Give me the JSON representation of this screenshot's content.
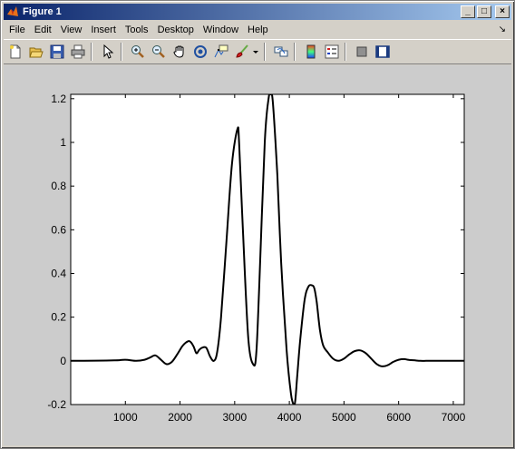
{
  "window": {
    "title": "Figure 1",
    "minimize_label": "_",
    "maximize_label": "□",
    "close_label": "×"
  },
  "menubar": {
    "items": [
      "File",
      "Edit",
      "View",
      "Insert",
      "Tools",
      "Desktop",
      "Window",
      "Help"
    ],
    "dock_arrow": "↘"
  },
  "toolbar": {
    "tools": [
      "new-figure-icon",
      "open-file-icon",
      "save-icon",
      "print-icon",
      "edit-plot-arrow-icon",
      "zoom-in-icon",
      "zoom-out-icon",
      "pan-hand-icon",
      "rotate-3d-icon",
      "data-cursor-icon",
      "brush-icon",
      "link-plot-icon",
      "colorbar-icon",
      "legend-icon",
      "hide-plot-tools-icon",
      "show-plot-tools-icon"
    ]
  },
  "colors": {
    "figure_bg": "#cccccc",
    "axes_bg": "#ffffff",
    "line": "#000000",
    "titlebar_start": "#0a246a",
    "titlebar_end": "#a6caf0"
  },
  "chart_data": {
    "type": "line",
    "title": "",
    "xlabel": "",
    "ylabel": "",
    "xlim": [
      0,
      7200
    ],
    "ylim": [
      -0.2,
      1.22
    ],
    "xticks": [
      1000,
      2000,
      3000,
      4000,
      5000,
      6000,
      7000
    ],
    "yticks": [
      -0.2,
      0,
      0.2,
      0.4,
      0.6,
      0.8,
      1,
      1.2
    ],
    "ytick_labels": [
      "-0.2",
      "0",
      "0.2",
      "0.4",
      "0.6",
      "0.8",
      "1",
      "1.2"
    ],
    "grid": false,
    "series": [
      {
        "x": [
          0,
          800,
          1000,
          1200,
          1350,
          1450,
          1550,
          1650,
          1750,
          1850,
          1950,
          2050,
          2150,
          2200,
          2250,
          2300,
          2350,
          2400,
          2480,
          2550,
          2620,
          2680,
          2750,
          2850,
          2950,
          3050,
          3080,
          3150,
          3250,
          3350,
          3400,
          3450,
          3550,
          3620,
          3660,
          3700,
          3780,
          3850,
          3950,
          4030,
          4080,
          4110,
          4150,
          4200,
          4280,
          4350,
          4420,
          4460,
          4500,
          4560,
          4620,
          4700,
          4800,
          4900,
          5000,
          5100,
          5200,
          5300,
          5400,
          5500,
          5600,
          5700,
          5800,
          5900,
          6000,
          6100,
          6150,
          6200,
          6300,
          6400,
          6500,
          6600,
          6800,
          7000,
          7200
        ],
        "y": [
          0,
          0.002,
          0.005,
          0.0,
          0.005,
          0.015,
          0.025,
          0.005,
          -0.015,
          -0.005,
          0.03,
          0.07,
          0.09,
          0.085,
          0.065,
          0.035,
          0.05,
          0.06,
          0.06,
          0.02,
          0.0,
          0.04,
          0.2,
          0.55,
          0.9,
          1.06,
          1.0,
          0.6,
          0.1,
          -0.02,
          0.05,
          0.35,
          1.0,
          1.2,
          1.22,
          1.18,
          0.85,
          0.45,
          0.05,
          -0.15,
          -0.2,
          -0.18,
          -0.05,
          0.1,
          0.28,
          0.34,
          0.345,
          0.33,
          0.27,
          0.14,
          0.07,
          0.04,
          0.01,
          0.0,
          0.01,
          0.03,
          0.045,
          0.048,
          0.035,
          0.01,
          -0.015,
          -0.025,
          -0.02,
          -0.005,
          0.005,
          0.008,
          0.006,
          0.004,
          0.002,
          0.0,
          0.0,
          0.0,
          0.0,
          0.0,
          0.0
        ]
      }
    ]
  }
}
